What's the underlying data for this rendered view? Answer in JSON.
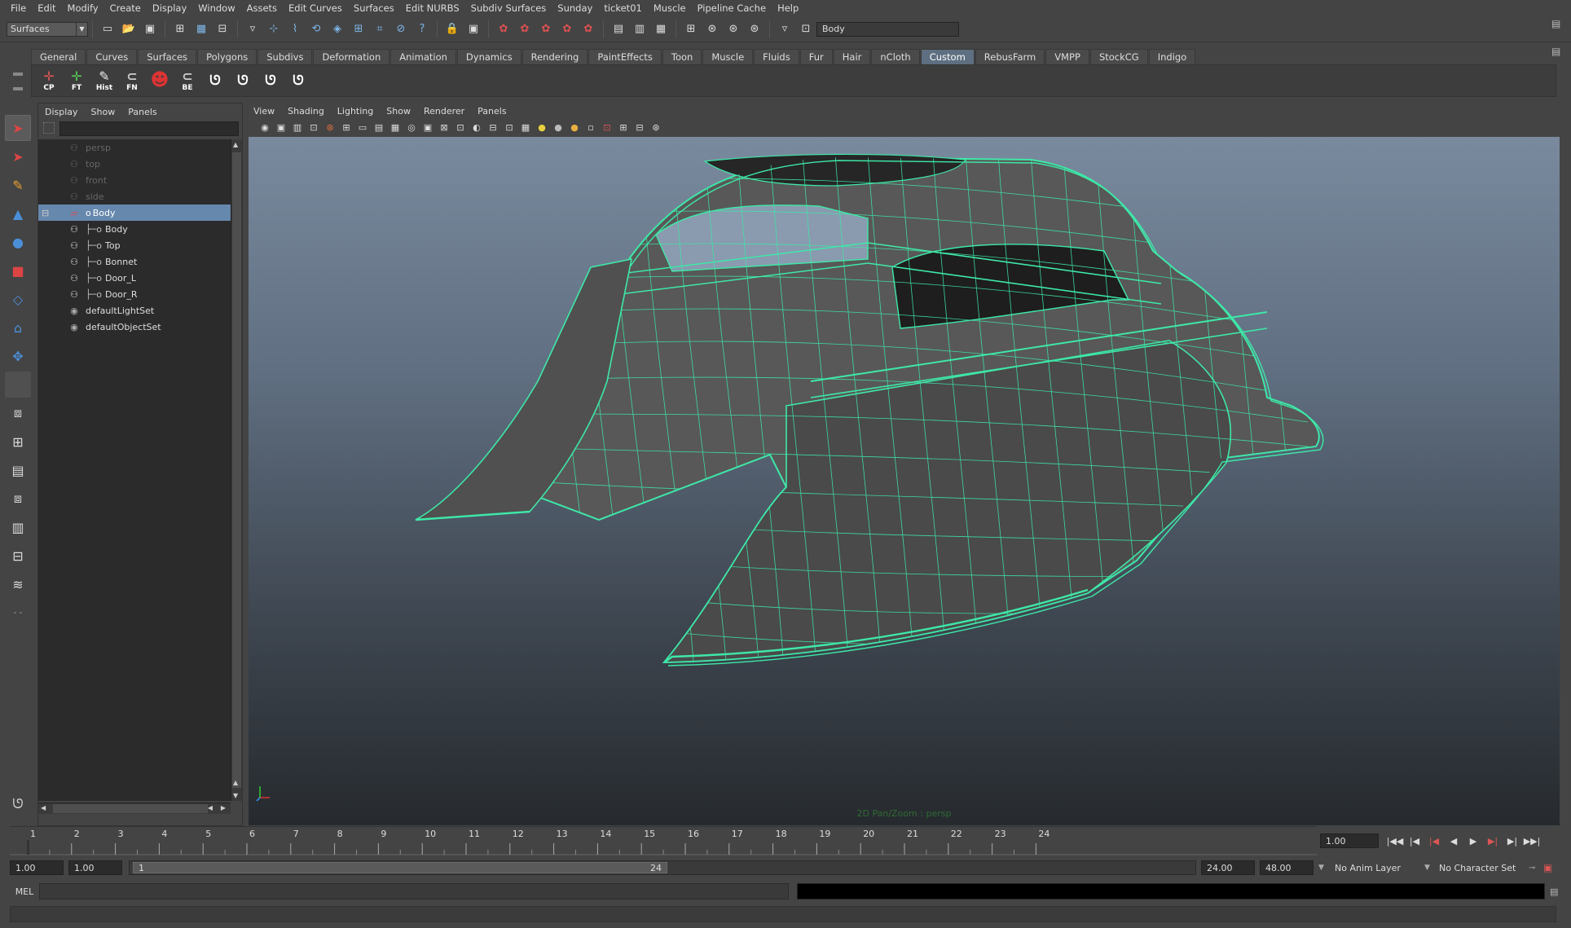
{
  "menubar": {
    "items": [
      "File",
      "Edit",
      "Modify",
      "Create",
      "Display",
      "Window",
      "Assets",
      "Edit Curves",
      "Surfaces",
      "Edit NURBS",
      "Subdiv Surfaces",
      "Sunday",
      "ticket01",
      "Muscle",
      "Pipeline Cache",
      "Help"
    ]
  },
  "statusline": {
    "menuset": "Surfaces",
    "selection_field": "Body"
  },
  "shelf": {
    "tabs": [
      "General",
      "Curves",
      "Surfaces",
      "Polygons",
      "Subdivs",
      "Deformation",
      "Animation",
      "Dynamics",
      "Rendering",
      "PaintEffects",
      "Toon",
      "Muscle",
      "Fluids",
      "Fur",
      "Hair",
      "nCloth",
      "Custom",
      "RebusFarm",
      "VMPP",
      "StockCG",
      "Indigo"
    ],
    "active_tab": "Custom",
    "buttons": [
      "CP",
      "FT",
      "Hist",
      "FN",
      "",
      "BE"
    ]
  },
  "outliner": {
    "menu": [
      "Display",
      "Show",
      "Panels"
    ],
    "rows": [
      {
        "label": "persp",
        "dim": true,
        "depth": 0
      },
      {
        "label": "top",
        "dim": true,
        "depth": 0
      },
      {
        "label": "front",
        "dim": true,
        "depth": 0
      },
      {
        "label": "side",
        "dim": true,
        "depth": 0
      },
      {
        "label": "Body",
        "selected": true,
        "depth": 0,
        "expanded": true
      },
      {
        "label": "Body",
        "depth": 1
      },
      {
        "label": "Top",
        "depth": 1
      },
      {
        "label": "Bonnet",
        "depth": 1
      },
      {
        "label": "Door_L",
        "depth": 1
      },
      {
        "label": "Door_R",
        "depth": 1
      },
      {
        "label": "defaultLightSet",
        "depth": 0,
        "set": true
      },
      {
        "label": "defaultObjectSet",
        "depth": 0,
        "set": true
      }
    ]
  },
  "viewport": {
    "menu": [
      "View",
      "Shading",
      "Lighting",
      "Show",
      "Renderer",
      "Panels"
    ],
    "hud": "2D Pan/Zoom : persp",
    "wire_color": "#3ee8a8"
  },
  "timeline": {
    "ticks": [
      1,
      2,
      3,
      4,
      5,
      6,
      7,
      8,
      9,
      10,
      11,
      12,
      13,
      14,
      15,
      16,
      17,
      18,
      19,
      20,
      21,
      22,
      23,
      24
    ],
    "current_frame": "1.00"
  },
  "range": {
    "start": "1.00",
    "playback_start": "1.00",
    "thumb_start": "1",
    "thumb_end": "24",
    "playback_end": "24.00",
    "end": "48.00",
    "anim_layer": "No Anim Layer",
    "char_set": "No Character Set"
  },
  "command": {
    "label": "MEL"
  }
}
